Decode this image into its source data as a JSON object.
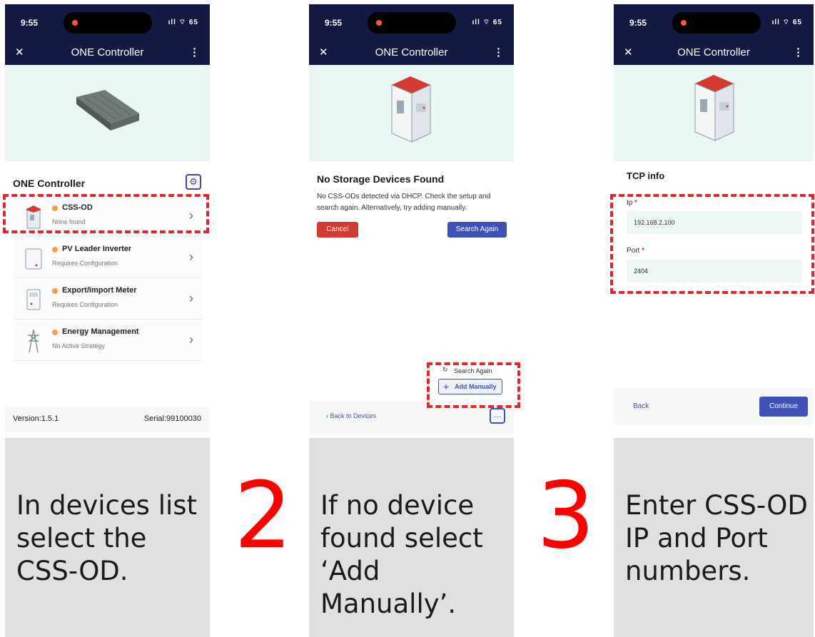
{
  "status": {
    "time": "9:55",
    "signal": "ıll ⌔ 65"
  },
  "app": {
    "title": "ONE Controller"
  },
  "panel1": {
    "section_title": "ONE Controller",
    "devices": [
      {
        "name": "CSS-OD",
        "status": "None found"
      },
      {
        "name": "PV Leader Inverter",
        "status": "Requires Configuration"
      },
      {
        "name": "Export/Import Meter",
        "status": "Requires Configuration"
      },
      {
        "name": "Energy Management",
        "status": "No Active Strategy"
      }
    ],
    "version": "Version:1.5.1",
    "serial": "Serial:99100030",
    "caption": "In devices list select the CSS-OD."
  },
  "step2": "2",
  "panel2": {
    "heading": "No Storage Devices Found",
    "message": "No CSS-ODs detected via DHCP. Check the setup and search again. Alternatively, try adding manually.",
    "cancel": "Cancel",
    "search_again": "Search Again",
    "menu_search_again": "Search Again",
    "menu_add_manually": "Add Manually",
    "back": "Back to Devices",
    "caption": "If no device found select ‘Add Manually’."
  },
  "step3": "3",
  "panel3": {
    "section_title": "TCP info",
    "ip_label": "Ip",
    "ip_value": "192.168.2.100",
    "port_label": "Port",
    "port_value": "2404",
    "back": "Back",
    "continue": "Continue",
    "caption": "Enter CSS-OD IP and Port numbers."
  },
  "colors": {
    "appbar": "#131941",
    "accent": "#3f51b5",
    "danger": "#d23a32",
    "highlight": "#e3262c",
    "step": "#ff0000"
  }
}
